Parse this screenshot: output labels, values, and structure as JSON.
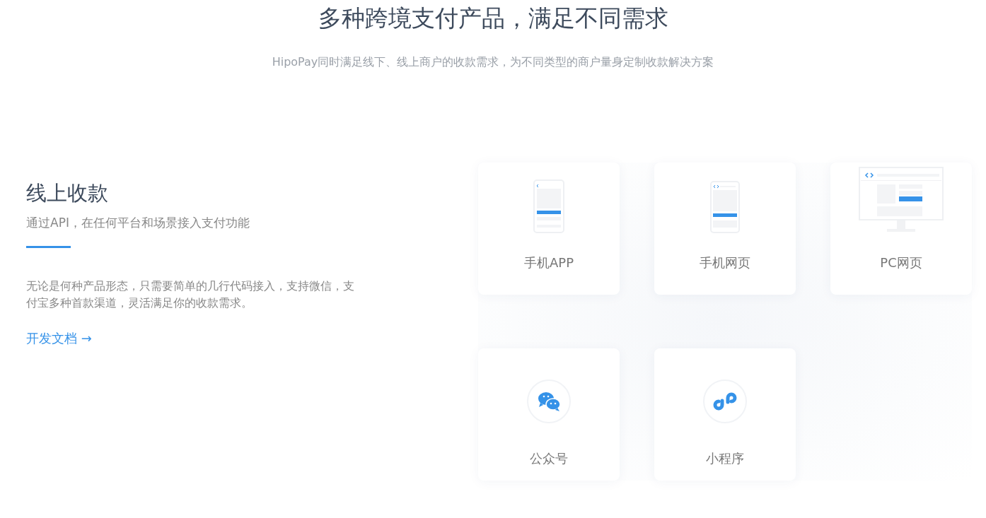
{
  "header": {
    "title": "多种跨境支付产品，满足不同需求",
    "subtitle": "HipoPay同时满足线下、线上商户的收款需求，为不同类型的商户量身定制收款解决方案"
  },
  "section": {
    "title": "线上收款",
    "tagline": "通过API，在任何平台和场景接入支付功能",
    "description": "无论是何种产品形态，只需要简单的几行代码接入，支持微信，支付宝多种首款渠道，灵活满足你的收款需求。",
    "link": "开发文档 →"
  },
  "products": [
    {
      "kind": "app",
      "label": "手机APP"
    },
    {
      "kind": "mobile-web",
      "label": "手机网页"
    },
    {
      "kind": "pc-web",
      "label": "PC网页"
    },
    {
      "kind": "wechat",
      "label": "公众号"
    },
    {
      "kind": "mini-program",
      "label": "小程序"
    }
  ]
}
